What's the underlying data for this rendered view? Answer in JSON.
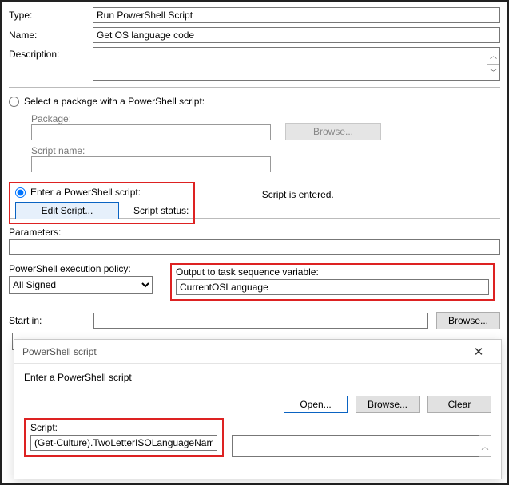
{
  "fields": {
    "type_label": "Type:",
    "type_value": "Run PowerShell Script",
    "name_label": "Name:",
    "name_value": "Get OS language code",
    "desc_label": "Description:"
  },
  "radios": {
    "select_pkg": "Select a package with a PowerShell script:",
    "enter_script": "Enter a PowerShell script:"
  },
  "pkg": {
    "package_label": "Package:",
    "script_name_label": "Script name:",
    "browse": "Browse..."
  },
  "script": {
    "edit_btn": "Edit Script...",
    "status_label": "Script status:",
    "status_value": "Script is entered."
  },
  "params": {
    "label": "Parameters:",
    "value": ""
  },
  "policy": {
    "label": "PowerShell execution policy:",
    "value": "All Signed"
  },
  "output": {
    "label": "Output to task sequence variable:",
    "value": "CurrentOSLanguage"
  },
  "startin": {
    "label": "Start in:",
    "value": "",
    "browse": "Browse..."
  },
  "dialog": {
    "title": "PowerShell script",
    "prompt": "Enter a PowerShell script",
    "open": "Open...",
    "browse": "Browse...",
    "clear": "Clear",
    "script_label": "Script:",
    "script_value": "(Get-Culture).TwoLetterISOLanguageName"
  }
}
